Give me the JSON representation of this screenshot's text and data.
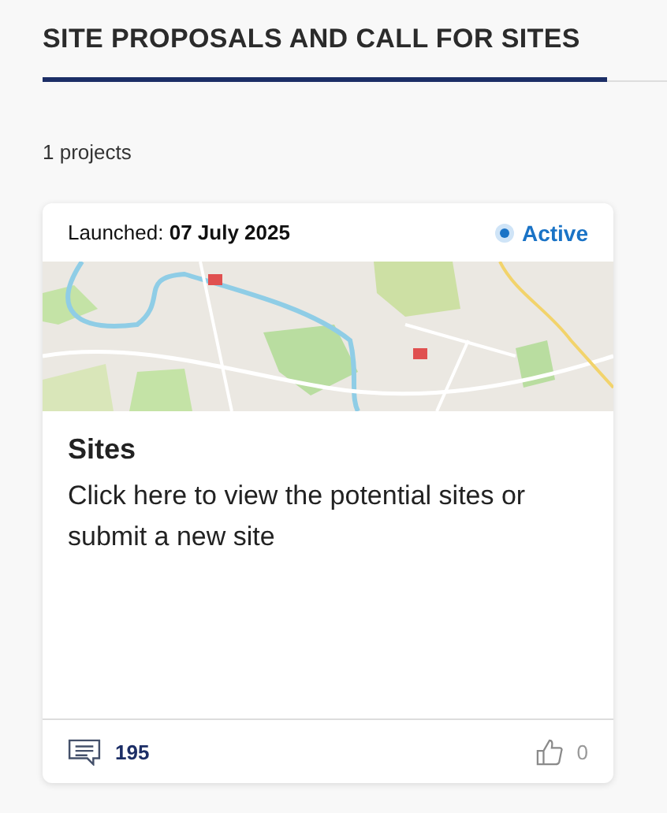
{
  "heading": "SITE PROPOSALS AND CALL FOR SITES",
  "project_count": "1 projects",
  "projects": [
    {
      "launched_label": "Launched:",
      "launched_date": "07 July 2025",
      "status": "Active",
      "title": "Sites",
      "description": "Click here to view the potential sites or submit a new site",
      "comments": "195",
      "likes": "0"
    }
  ]
}
